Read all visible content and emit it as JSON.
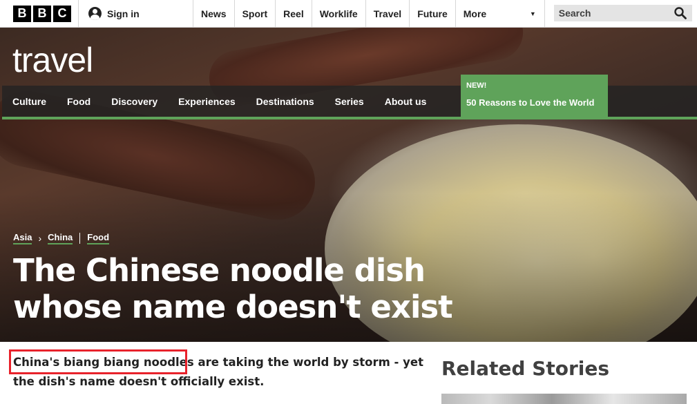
{
  "topbar": {
    "logo_letters": [
      "B",
      "B",
      "C"
    ],
    "signin_label": "Sign in",
    "nav_items": [
      "News",
      "Sport",
      "Reel",
      "Worklife",
      "Travel",
      "Future"
    ],
    "more_label": "More",
    "search_placeholder": "Search"
  },
  "travel": {
    "logo_text": "travel",
    "subnav": [
      "Culture",
      "Food",
      "Discovery",
      "Experiences",
      "Destinations",
      "Series",
      "About us"
    ],
    "promo": {
      "new_label": "NEW!",
      "text": "50 Reasons to Love the World"
    }
  },
  "article": {
    "breadcrumbs": [
      "Asia",
      "China",
      "Food"
    ],
    "headline": "The Chinese noodle dish whose name doesn't exist",
    "summary": "China's biang biang noodles are taking the world by storm - yet the dish's name doesn't officially exist."
  },
  "sidebar": {
    "related_title": "Related Stories"
  },
  "colors": {
    "accent_green": "#5fa35a",
    "highlight_red": "#e8222b",
    "bbc_black": "#000000"
  },
  "icons": [
    "user-icon",
    "chevron-down-icon",
    "search-icon",
    "chevron-right-icon"
  ]
}
